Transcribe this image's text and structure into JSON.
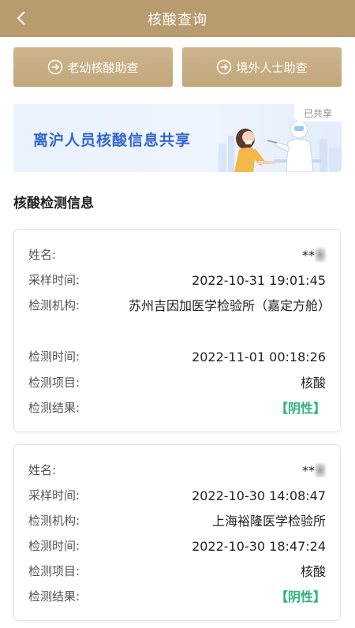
{
  "header": {
    "title": "核酸查询"
  },
  "actions": {
    "elderly_check_label": "老幼核酸助查",
    "overseas_check_label": "境外人士助查"
  },
  "banner": {
    "text": "离沪人员核酸信息共享",
    "tag": "已共享",
    "colors": {
      "text": "#3366d4",
      "background": "#e9f2fd"
    }
  },
  "section": {
    "title": "核酸检测信息"
  },
  "labels": {
    "name": "姓名:",
    "sample_time": "采样时间:",
    "institution": "检测机构:",
    "test_time": "检测时间:",
    "item": "检测项目:",
    "result": "检测结果:"
  },
  "records": [
    {
      "name": "**",
      "sample_time": "2022-10-31 19:01:45",
      "institution": "苏州吉因加医学检验所（嘉定方舱）",
      "test_time": "2022-11-01 00:18:26",
      "item": "核酸",
      "result": "【阴性】"
    },
    {
      "name": "**",
      "sample_time": "2022-10-30 14:08:47",
      "institution": "上海裕隆医学检验所",
      "test_time": "2022-10-30 18:47:24",
      "item": "核酸",
      "result": "【阴性】"
    }
  ],
  "theme": {
    "header": "#b89b6e",
    "button": "#c5ab80",
    "result": "#2ab37a"
  },
  "icons": {
    "back": "chevron-left-icon",
    "action": "arrow-circle-icon"
  }
}
